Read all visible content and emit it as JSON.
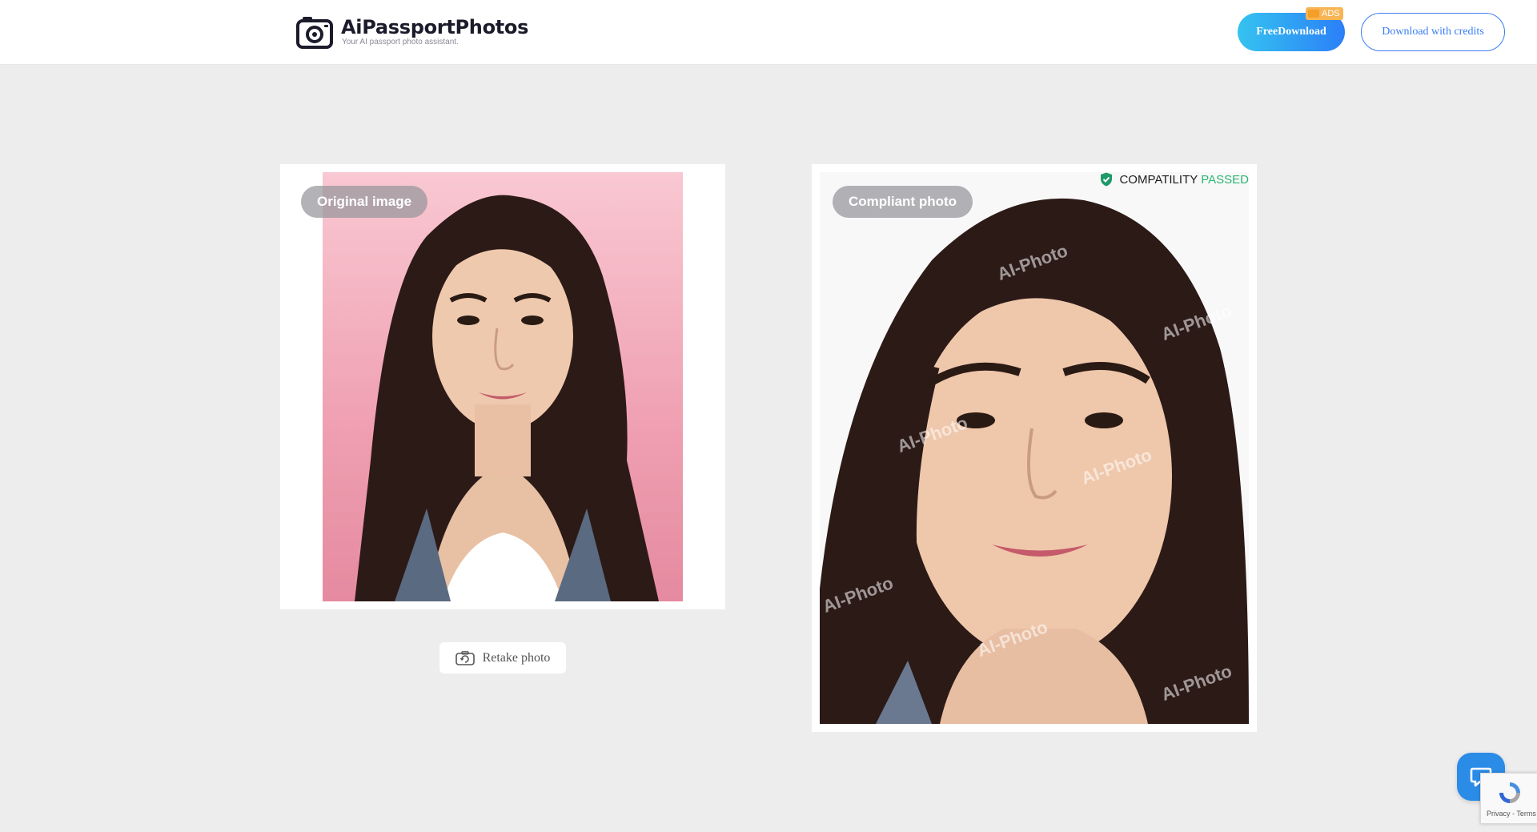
{
  "header": {
    "brand_title": "AiPassportPhotos",
    "brand_subtitle": "Your AI passport photo assistant.",
    "free_download_label": "FreeDownload",
    "ads_badge": "ADS",
    "download_credits_label": "Download with credits"
  },
  "original": {
    "label": "Original image",
    "retake_label": "Retake photo"
  },
  "compliant": {
    "label": "Compliant photo",
    "status_prefix": "COMPATILITY",
    "status_value": "PASSED",
    "watermark": "AI-Photo"
  },
  "recaptcha": {
    "text": "Privacy - Terms"
  },
  "colors": {
    "accent_blue": "#3a7df3",
    "passed_green": "#2bb673",
    "original_background": "#f2a9b9"
  }
}
